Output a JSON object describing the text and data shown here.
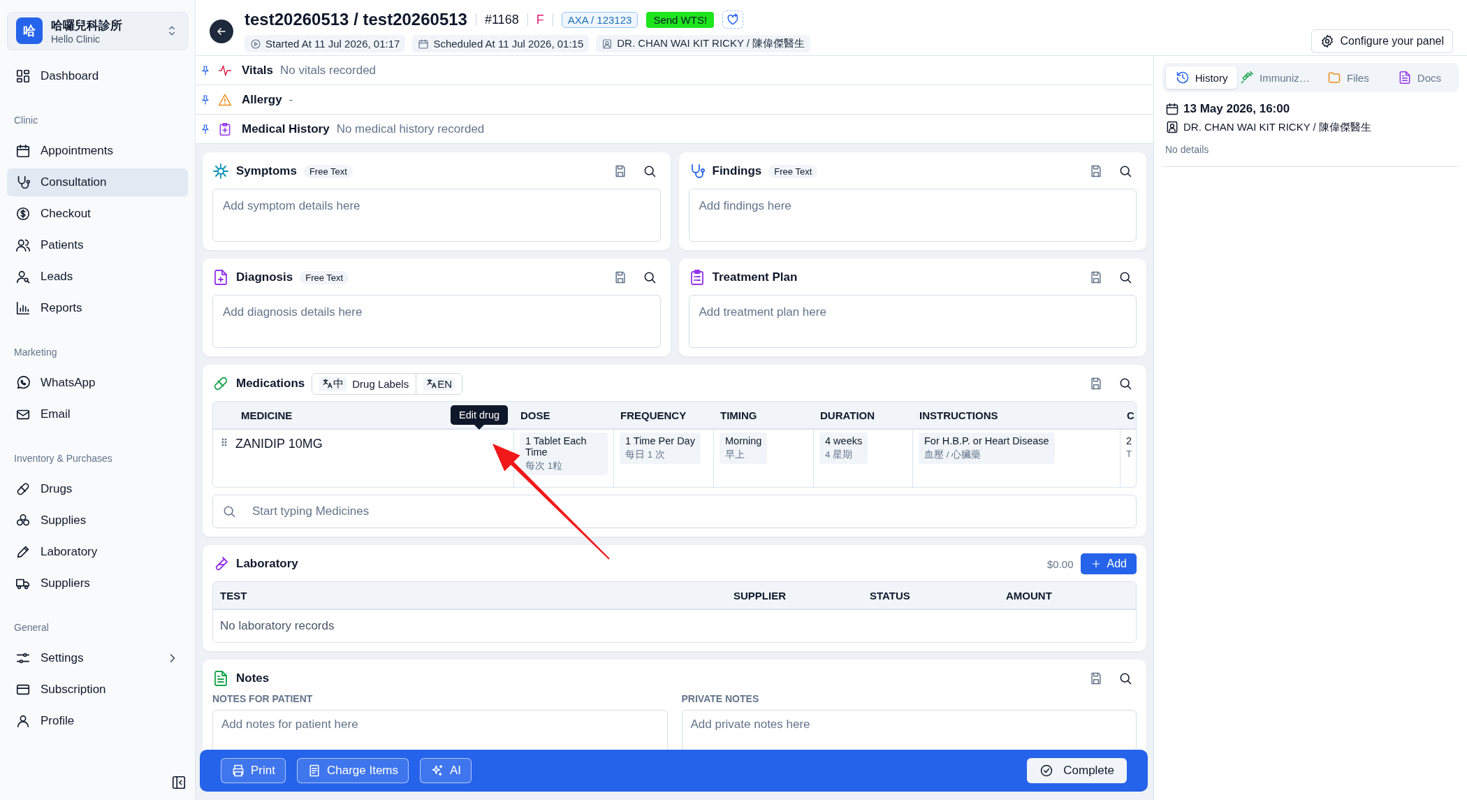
{
  "sidebar": {
    "clinic": {
      "badge": "哈",
      "name": "哈囉兒科診所",
      "subtitle": "Hello Clinic"
    },
    "nav": [
      {
        "kind": "item",
        "label": "Dashboard",
        "selected": false,
        "submenu": false
      },
      {
        "kind": "heading",
        "label": "Clinic"
      },
      {
        "kind": "item",
        "label": "Appointments",
        "selected": false,
        "submenu": false
      },
      {
        "kind": "item",
        "label": "Consultation",
        "selected": true,
        "submenu": false
      },
      {
        "kind": "item",
        "label": "Checkout",
        "selected": false,
        "submenu": false
      },
      {
        "kind": "item",
        "label": "Patients",
        "selected": false,
        "submenu": false
      },
      {
        "kind": "item",
        "label": "Leads",
        "selected": false,
        "submenu": false
      },
      {
        "kind": "item",
        "label": "Reports",
        "selected": false,
        "submenu": false
      },
      {
        "kind": "heading",
        "label": "Marketing"
      },
      {
        "kind": "item",
        "label": "WhatsApp",
        "selected": false,
        "submenu": false
      },
      {
        "kind": "item",
        "label": "Email",
        "selected": false,
        "submenu": false
      },
      {
        "kind": "heading",
        "label": "Inventory & Purchases"
      },
      {
        "kind": "item",
        "label": "Drugs",
        "selected": false,
        "submenu": false
      },
      {
        "kind": "item",
        "label": "Supplies",
        "selected": false,
        "submenu": false
      },
      {
        "kind": "item",
        "label": "Laboratory",
        "selected": false,
        "submenu": false
      },
      {
        "kind": "item",
        "label": "Suppliers",
        "selected": false,
        "submenu": false
      },
      {
        "kind": "heading",
        "label": "General"
      },
      {
        "kind": "item",
        "label": "Settings",
        "selected": false,
        "submenu": true
      },
      {
        "kind": "item",
        "label": "Subscription",
        "selected": false,
        "submenu": false
      },
      {
        "kind": "item",
        "label": "Profile",
        "selected": false,
        "submenu": false
      }
    ]
  },
  "header": {
    "title": "test20260513 / test20260513",
    "number": "#1168",
    "gender": "F",
    "insurance": "AXA / 123123",
    "send_button": "Send WTS!",
    "chips": [
      "Started At 11 Jul 2026, 01:17",
      "Scheduled At 11 Jul 2026, 01:15",
      "DR. CHAN WAI KIT RICKY / 陳偉傑醫生"
    ],
    "configure_button": "Configure your panel"
  },
  "pinned": [
    {
      "title": "Vitals",
      "value": "No vitals recorded"
    },
    {
      "title": "Allergy",
      "value": "-"
    },
    {
      "title": "Medical History",
      "value": "No medical history recorded"
    }
  ],
  "cards": [
    {
      "title": "Symptoms",
      "tag": "Free Text",
      "placeholder": "Add symptom details here"
    },
    {
      "title": "Findings",
      "tag": "Free Text",
      "placeholder": "Add findings here"
    },
    {
      "title": "Diagnosis",
      "tag": "Free Text",
      "placeholder": "Add diagnosis details here"
    },
    {
      "title": "Treatment Plan",
      "placeholder": "Add treatment plan here"
    }
  ],
  "medications": {
    "title": "Medications",
    "label_options": [
      {
        "code": "中",
        "label": "Drug Labels"
      },
      {
        "code": "EN"
      }
    ],
    "columns": [
      "MEDICINE",
      "DOSE",
      "FREQUENCY",
      "TIMING",
      "DURATION",
      "INSTRUCTIONS",
      "C"
    ],
    "rows": [
      {
        "cells": [
          {
            "main": "ZANIDIP 10MG"
          },
          {
            "main": "1 Tablet Each Time",
            "sub": "每次 1粒"
          },
          {
            "main": "1 Time Per Day",
            "sub": "每日 1 次"
          },
          {
            "main": "Morning",
            "sub": "早上"
          },
          {
            "main": "4 weeks",
            "sub": "4 星期"
          },
          {
            "main": "For H.B.P. or Heart Disease",
            "sub": "血壓 / 心臟藥"
          },
          {
            "main": "2",
            "sub": "T"
          }
        ]
      }
    ],
    "tooltip": "Edit drug",
    "search": {
      "placeholder": "Start typing Medicines"
    }
  },
  "laboratory": {
    "title": "Laboratory",
    "total": "$0.00",
    "add_button": "Add",
    "columns": [
      "TEST",
      "SUPPLIER",
      "STATUS",
      "AMOUNT"
    ],
    "empty": "No laboratory records"
  },
  "notes": {
    "title": "Notes",
    "fields": [
      {
        "label": "NOTES FOR PATIENT",
        "placeholder": "Add notes for patient here"
      },
      {
        "label": "PRIVATE NOTES",
        "placeholder": "Add private notes here"
      }
    ]
  },
  "bottom_bar": {
    "buttons": [
      "Print",
      "Charge Items",
      "AI"
    ],
    "complete_button": "Complete"
  },
  "panel": {
    "tabs": [
      {
        "label": "History",
        "selected": true
      },
      {
        "label": "Immuniz…",
        "selected": false
      },
      {
        "label": "Files",
        "selected": false
      },
      {
        "label": "Docs",
        "selected": false
      }
    ],
    "entries": [
      {
        "date": "13 May 2026, 16:00",
        "doctor": "DR. CHAN WAI KIT RICKY / 陳偉傑醫生",
        "details": "No details"
      }
    ]
  }
}
